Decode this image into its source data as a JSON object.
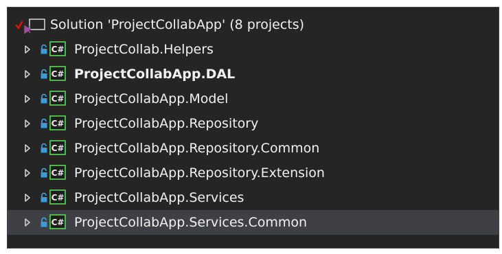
{
  "solution": {
    "label": "Solution 'ProjectCollabApp' (8 projects)"
  },
  "projects": [
    {
      "label": "ProjectCollab.Helpers"
    },
    {
      "label": "ProjectCollabApp.DAL"
    },
    {
      "label": "ProjectCollabApp.Model"
    },
    {
      "label": "ProjectCollabApp.Repository"
    },
    {
      "label": "ProjectCollabApp.Repository.Common"
    },
    {
      "label": "ProjectCollabApp.Repository.Extension"
    },
    {
      "label": "ProjectCollabApp.Services"
    },
    {
      "label": "ProjectCollabApp.Services.Common"
    }
  ],
  "icons": {
    "expander": "collapsed-arrow-icon",
    "lock": "lock-icon",
    "project": "csharp-project-icon",
    "solution": "solution-icon",
    "status": "red-check-icon"
  },
  "colors": {
    "background": "#252526",
    "selected_row": "#3f3f46",
    "text": "#f1f1f1",
    "lock": "#3c9ad5",
    "csharp_border": "#4ec94e",
    "solution_purple": "#9b4f96",
    "check_red": "#e51400"
  },
  "selected_project_index": 7,
  "bold_project_index": 1
}
